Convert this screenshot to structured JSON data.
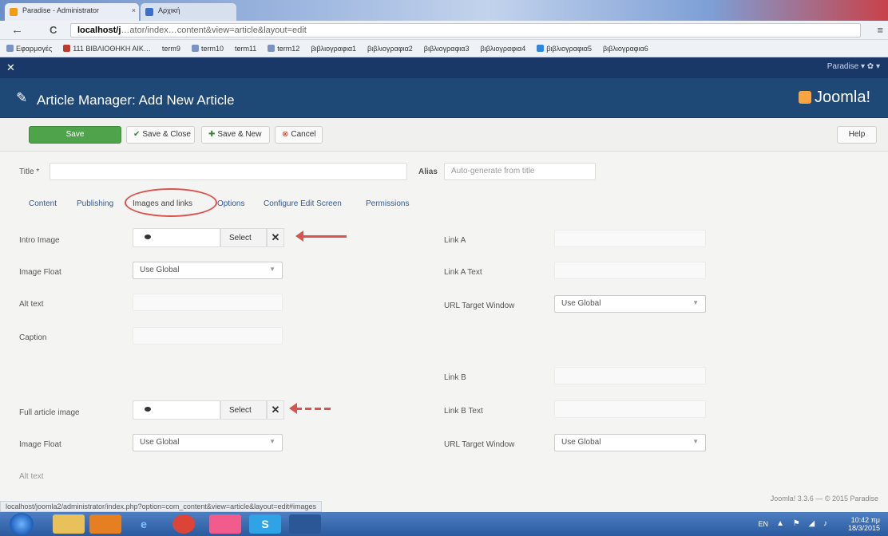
{
  "browser": {
    "tabs": [
      {
        "label": "Paradise - Administrator",
        "close": "×"
      },
      {
        "label": "Αρχική",
        "close": ""
      }
    ],
    "back": "←",
    "reload": "C",
    "address_host": "localhost/j",
    "address_rest": "…ator/index…content&view=article&layout=edit",
    "menu": "≡",
    "bookmarks": [
      "Εφαρμογές",
      "111 ΒΙΒΛΙΟΘΗΚΗ ΑΙΚ…",
      "term9",
      "term10",
      "term11",
      "term12",
      "βιβλιογραφια1",
      "βιβλιογραφια2",
      "βιβλιογραφια3",
      "βιβλιογραφια4",
      "βιβλιογραφια5",
      "βιβλιογραφια6"
    ]
  },
  "joomla_nav": {
    "logo": "✕",
    "right": "Paradise ▾  ✿ ▾"
  },
  "header": {
    "pencil": "✎",
    "title": "Article Manager: Add New Article",
    "brand": "Joomla!"
  },
  "toolbar": {
    "save": "Save",
    "save_close": "Save & Close",
    "save_new": "Save & New",
    "cancel": "Cancel",
    "help": "Help",
    "check_icon": "✔",
    "plus_icon": "✚",
    "cancel_icon": "⊗"
  },
  "form": {
    "title_label": "Title *",
    "alias_label": "Alias",
    "alias_placeholder": "Auto-generate from title"
  },
  "tabs": [
    "Content",
    "Publishing",
    "Images and links",
    "Options",
    "Configure Edit Screen",
    "Permissions"
  ],
  "images": {
    "intro_label": "Intro Image",
    "select_label": "Select",
    "clear_icon": "✕",
    "image_float_label": "Image Float",
    "use_global": "Use Global",
    "caret": "▼",
    "alt_text_label": "Alt text",
    "caption_label": "Caption",
    "full_label": "Full article image",
    "image_float_label_2": "Image Float",
    "alt_text_label_2": "Alt text"
  },
  "links": {
    "link_a": "Link A",
    "link_a_text": "Link A Text",
    "url_target_window": "URL Target Window",
    "use_global": "Use Global",
    "link_b": "Link B",
    "link_b_text": "Link B Text",
    "url_target_window_2": "URL Target Window"
  },
  "status": {
    "url": "localhost/joomla2/administrator/index.php?option=com_content&view=article&layout=edit#images",
    "footer": "Joomla! 3.3.6 — © 2015 Paradise"
  },
  "taskbar": {
    "lang": "EN",
    "time": "10:42 πμ",
    "date": "18/3/2015",
    "tray": "▲ ⚑ ◢ ♪"
  },
  "colors": {
    "header_bg": "#1e4876",
    "save_green": "#4fa34a",
    "annotation_red": "#d9534f"
  }
}
